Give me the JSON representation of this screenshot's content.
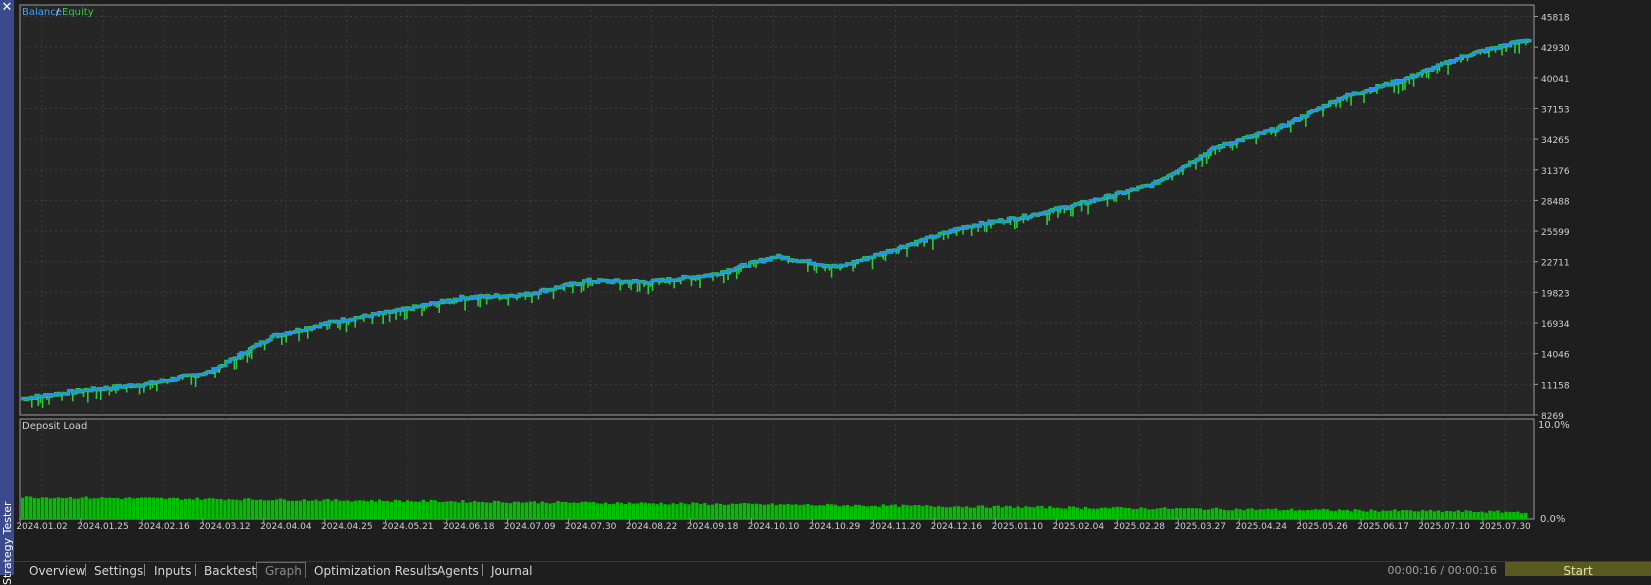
{
  "panel": {
    "title": "Strategy Tester",
    "close_symbol": "✕"
  },
  "legend": {
    "balance_label": "Balance",
    "separator": "/",
    "equity_label": "Equity"
  },
  "lower_panel": {
    "title": "Deposit Load",
    "ymax_label": "10.0%",
    "ymin_label": "0.0%"
  },
  "tabs": [
    {
      "label": "Overview",
      "active": false
    },
    {
      "label": "Settings",
      "active": false
    },
    {
      "label": "Inputs",
      "active": false
    },
    {
      "label": "Backtest",
      "active": false
    },
    {
      "label": "Graph",
      "active": true
    },
    {
      "label": "Optimization Results",
      "active": false
    },
    {
      "label": "Agents",
      "active": false
    },
    {
      "label": "Journal",
      "active": false
    }
  ],
  "status": {
    "timer": "00:00:16 / 00:00:16",
    "start_label": "Start"
  },
  "colors": {
    "balance": "#1e90ff",
    "equity": "#2ecc40",
    "deposit_load": "#00c000",
    "plot_bg": "#262626",
    "grid": "#3c3c3c"
  },
  "chart_data": [
    {
      "type": "line",
      "series": [
        {
          "name": "Balance",
          "color": "#1e90ff"
        },
        {
          "name": "Equity",
          "color": "#2ecc40"
        }
      ],
      "x": [
        "2024.01.02",
        "2024.01.25",
        "2024.02.16",
        "2024.03.12",
        "2024.04.04",
        "2024.04.25",
        "2024.05.21",
        "2024.06.18",
        "2024.07.09",
        "2024.07.30",
        "2024.08.22",
        "2024.09.18",
        "2024.10.10",
        "2024.10.29",
        "2024.11.20",
        "2024.12.16",
        "2025.01.10",
        "2025.02.04",
        "2025.02.28",
        "2025.03.27",
        "2025.04.24",
        "2025.05.26",
        "2025.06.17",
        "2025.07.10",
        "2025.07.30"
      ],
      "balance": [
        9800,
        10600,
        11200,
        12300,
        15700,
        17100,
        18100,
        19300,
        19600,
        20900,
        20800,
        21500,
        23200,
        22200,
        24100,
        26000,
        27000,
        28400,
        30000,
        33500,
        35300,
        38200,
        39900,
        42200,
        43700
      ],
      "ytick_labels": [
        "45818",
        "42930",
        "40041",
        "37153",
        "34265",
        "31376",
        "28488",
        "25599",
        "22711",
        "19823",
        "16934",
        "14046",
        "11158",
        "8269"
      ],
      "ylim": [
        8269,
        46900
      ],
      "grid": true,
      "legend_position": "top-left"
    },
    {
      "type": "bar",
      "title": "Deposit Load",
      "ylim": [
        0,
        10
      ],
      "ytick_labels": [
        "10.0%",
        "0.0%"
      ],
      "values_start": 2.2,
      "values_end": 0.7
    }
  ]
}
